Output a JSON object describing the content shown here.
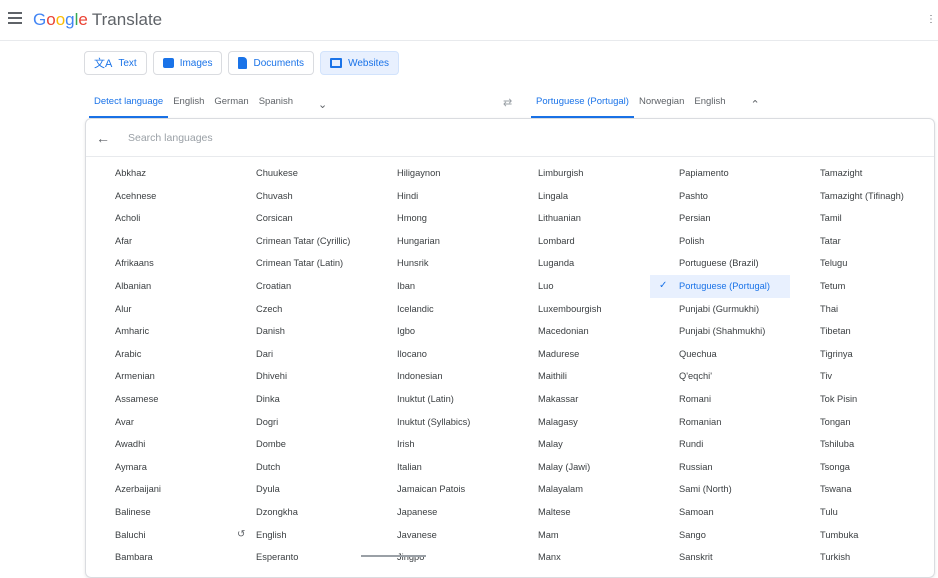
{
  "app": {
    "name_google": "Google",
    "name_translate": "Translate"
  },
  "modes": [
    {
      "label": "Text",
      "icon": "translate-icon"
    },
    {
      "label": "Images",
      "icon": "image-icon"
    },
    {
      "label": "Documents",
      "icon": "document-icon"
    },
    {
      "label": "Websites",
      "icon": "website-icon",
      "active": true
    }
  ],
  "source_langs": [
    "Detect language",
    "English",
    "German",
    "Spanish"
  ],
  "target_langs": [
    "Portuguese (Portugal)",
    "Norwegian",
    "English"
  ],
  "search": {
    "placeholder": "Search languages"
  },
  "selected": "Portuguese (Portugal)",
  "recent": [
    "English"
  ],
  "columns": [
    [
      "Abkhaz",
      "Acehnese",
      "Acholi",
      "Afar",
      "Afrikaans",
      "Albanian",
      "Alur",
      "Amharic",
      "Arabic",
      "Armenian",
      "Assamese",
      "Avar",
      "Awadhi",
      "Aymara",
      "Azerbaijani",
      "Balinese",
      "Baluchi",
      "Bambara"
    ],
    [
      "Chuukese",
      "Chuvash",
      "Corsican",
      "Crimean Tatar (Cyrillic)",
      "Crimean Tatar (Latin)",
      "Croatian",
      "Czech",
      "Danish",
      "Dari",
      "Dhivehi",
      "Dinka",
      "Dogri",
      "Dombe",
      "Dutch",
      "Dyula",
      "Dzongkha",
      "English",
      "Esperanto"
    ],
    [
      "Hiligaynon",
      "Hindi",
      "Hmong",
      "Hungarian",
      "Hunsrik",
      "Iban",
      "Icelandic",
      "Igbo",
      "Ilocano",
      "Indonesian",
      "Inuktut (Latin)",
      "Inuktut (Syllabics)",
      "Irish",
      "Italian",
      "Jamaican Patois",
      "Japanese",
      "Javanese",
      "Jingpo"
    ],
    [
      "Limburgish",
      "Lingala",
      "Lithuanian",
      "Lombard",
      "Luganda",
      "Luo",
      "Luxembourgish",
      "Macedonian",
      "Madurese",
      "Maithili",
      "Makassar",
      "Malagasy",
      "Malay",
      "Malay (Jawi)",
      "Malayalam",
      "Maltese",
      "Mam",
      "Manx"
    ],
    [
      "Papiamento",
      "Pashto",
      "Persian",
      "Polish",
      "Portuguese (Brazil)",
      "Portuguese (Portugal)",
      "Punjabi (Gurmukhi)",
      "Punjabi (Shahmukhi)",
      "Quechua",
      "Q'eqchi'",
      "Romani",
      "Romanian",
      "Rundi",
      "Russian",
      "Sami (North)",
      "Samoan",
      "Sango",
      "Sanskrit"
    ],
    [
      "Tamazight",
      "Tamazight (Tifinagh)",
      "Tamil",
      "Tatar",
      "Telugu",
      "Tetum",
      "Thai",
      "Tibetan",
      "Tigrinya",
      "Tiv",
      "Tok Pisin",
      "Tongan",
      "Tshiluba",
      "Tsonga",
      "Tswana",
      "Tulu",
      "Tumbuka",
      "Turkish"
    ]
  ],
  "colors": {
    "accent": "#1a73e8",
    "selected_bg": "#e8f0fe"
  }
}
